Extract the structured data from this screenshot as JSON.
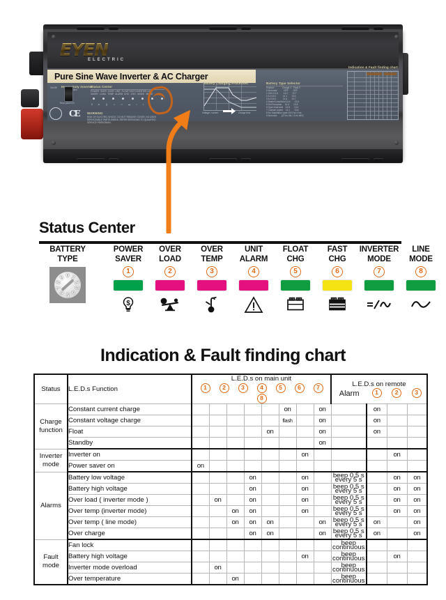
{
  "product": {
    "brand": "EYEN",
    "brand_sub": "ELECTRIC",
    "title_strip": "Pure Sine Wave Inverter & AC Charger",
    "panel_sections": {
      "heavy_duty": "Heavy Duty Inverter",
      "heavy_duty_sub": "Power switch",
      "status_center": "Status Center",
      "warning": "WARNING",
      "warning_body": "RISK OF ELECTRIC SHOCK. DO NOT REMOVE COVER. NO USER SERVICEABLE PARTS INSIDE. REFER SERVICING TO QUALIFIED SERVICE PERSONNEL.",
      "charging": "Battery Charging Processes",
      "charging_x": "Charge time",
      "charging_y": "Voltage / Current",
      "selector_title": "Battery Type Selector",
      "selector_cols": [
        "Position",
        "Charge V",
        "Float V"
      ],
      "selector_rows": [
        [
          "0 Not used",
          "OFF",
          "OFF"
        ],
        [
          "1 Gel U.S.A",
          "14.2",
          "13.7"
        ],
        [
          "2 A.G.M 1",
          "14.1",
          "13.4"
        ],
        [
          "3 A.G.M 2",
          "14.6",
          "13.7"
        ],
        [
          "4 Sealed Lead Acid",
          "14.4",
          "13.6"
        ],
        [
          "5 Gel European",
          "14.4",
          "13.8"
        ],
        [
          "6 Open lead acid",
          "14.8",
          "13.3"
        ],
        [
          "7 Calcium (open)",
          "14.1",
          "13.6"
        ],
        [
          "8 De Sulphation cycle 15.5 for 4 hrs",
          "",
          ""
        ],
        [
          "9 Not used",
          "(12 for 24v / 4 for 48V)",
          ""
        ]
      ],
      "chart_title": "Indication & Fault finding chart",
      "ce_mark": "CE"
    }
  },
  "status_center": {
    "title": "Status Center",
    "battery_type": {
      "line1": "BATTERY",
      "line2": "TYPE"
    },
    "dial": {
      "digits": [
        "0",
        "1",
        "2",
        "3",
        "4",
        "5",
        "6",
        "7",
        "8",
        "9"
      ]
    },
    "leds": [
      {
        "line1": "POWER",
        "line2": "SAVER",
        "number": "①",
        "color": "#00a14b",
        "icon": "power-saver-icon"
      },
      {
        "line1": "OVER",
        "line2": "LOAD",
        "number": "②",
        "color": "#e51080",
        "icon": "overload-scale-icon"
      },
      {
        "line1": "OVER",
        "line2": "TEMP",
        "number": "③",
        "color": "#e51080",
        "icon": "thermometer-icon"
      },
      {
        "line1": "UNIT",
        "line2": "ALARM",
        "number": "④",
        "color": "#e51080",
        "icon": "warning-triangle-icon"
      },
      {
        "line1": "FLOAT",
        "line2": "CHG",
        "number": "⑤",
        "color": "#0f9d3f",
        "icon": "battery-float-icon"
      },
      {
        "line1": "FAST",
        "line2": "CHG",
        "number": "⑥",
        "color": "#f5e314",
        "icon": "battery-fast-icon"
      },
      {
        "line1": "INVERTER",
        "line2": "MODE",
        "number": "⑦",
        "color": "#0f9d3f",
        "icon": "dc-ac-icon"
      },
      {
        "line1": "LINE",
        "line2": "MODE",
        "number": "⑧",
        "color": "#0f9d3f",
        "icon": "ac-wave-icon"
      }
    ]
  },
  "fault_chart": {
    "title": "Indication & Fault finding chart",
    "headers": {
      "status": "Status",
      "function": "L.E.D.s Function",
      "main_unit": "L.E.D.s on main unit",
      "remote": "L.E.D.s on remote",
      "alarm": "Alarm",
      "main_numbers": [
        "①",
        "②",
        "③",
        "④",
        "⑤",
        "⑥",
        "⑦",
        "⑧"
      ],
      "remote_numbers": [
        "①",
        "②",
        "③"
      ]
    },
    "groups": [
      {
        "name": "Charge\nfunction",
        "name_lines": [
          "Charge",
          "function"
        ],
        "rows": [
          {
            "function": "Constant current charge",
            "main": [
              "",
              "",
              "",
              "",
              "",
              "on",
              "",
              "on"
            ],
            "alarm": "",
            "remote": [
              "on",
              "",
              ""
            ]
          },
          {
            "function": "Constant voltage charge",
            "main": [
              "",
              "",
              "",
              "",
              "",
              "flash",
              "",
              "on"
            ],
            "alarm": "",
            "remote": [
              "on",
              "",
              ""
            ]
          },
          {
            "function": "Float",
            "main": [
              "",
              "",
              "",
              "",
              "on",
              "",
              "",
              "on"
            ],
            "alarm": "",
            "remote": [
              "on",
              "",
              ""
            ]
          },
          {
            "function": "Standby",
            "main": [
              "",
              "",
              "",
              "",
              "",
              "",
              "",
              "on"
            ],
            "alarm": "",
            "remote": [
              "",
              "",
              ""
            ]
          }
        ]
      },
      {
        "name_lines": [
          "Inverter",
          "mode"
        ],
        "rows": [
          {
            "function": "Inverter on",
            "main": [
              "",
              "",
              "",
              "",
              "",
              "",
              "on",
              ""
            ],
            "alarm": "",
            "remote": [
              "",
              "on",
              ""
            ]
          },
          {
            "function": "Power saver on",
            "main": [
              "on",
              "",
              "",
              "",
              "",
              "",
              "",
              ""
            ],
            "alarm": "",
            "remote": [
              "",
              "",
              ""
            ]
          }
        ]
      },
      {
        "name_lines": [
          "Alarms"
        ],
        "rows": [
          {
            "function": "Battery low voltage",
            "main": [
              "",
              "",
              "",
              "on",
              "",
              "",
              "on",
              ""
            ],
            "alarm": "beep 0.5 s\nevery 5 s",
            "remote": [
              "",
              "on",
              "on"
            ]
          },
          {
            "function": "Battery  high voltage",
            "main": [
              "",
              "",
              "",
              "on",
              "",
              "",
              "on",
              ""
            ],
            "alarm": "beep 0.5 s\nevery 5 s",
            "remote": [
              "",
              "on",
              "on"
            ]
          },
          {
            "function": "Over load ( inverter mode )",
            "main": [
              "",
              "on",
              "",
              "on",
              "",
              "",
              "on",
              ""
            ],
            "alarm": "beep 0.5 s\nevery 5 s",
            "remote": [
              "",
              "on",
              "on"
            ]
          },
          {
            "function": "Over temp (inverter mode)",
            "main": [
              "",
              "",
              "on",
              "on",
              "",
              "",
              "on",
              ""
            ],
            "alarm": "beep 0.5 s\nevery 5 s",
            "remote": [
              "",
              "on",
              "on"
            ]
          },
          {
            "function": "Over temp ( line mode)",
            "main": [
              "",
              "",
              "on",
              "on",
              "on",
              "",
              "",
              "on"
            ],
            "alarm": "beep 0.5 s\nevery 5 s",
            "remote": [
              "on",
              "",
              "on"
            ]
          },
          {
            "function": "Over charge",
            "main": [
              "",
              "",
              "",
              "on",
              "on",
              "",
              "",
              "on"
            ],
            "alarm": "beep 0.5 s\nevery 5 s",
            "remote": [
              "on",
              "",
              "on"
            ]
          }
        ]
      },
      {
        "name_lines": [
          "Fault",
          "mode"
        ],
        "rows": [
          {
            "function": "Fan lock",
            "main": [
              "",
              "",
              "",
              "",
              "",
              "",
              "",
              ""
            ],
            "alarm": "beep\ncontinuous",
            "remote": [
              "",
              "",
              ""
            ]
          },
          {
            "function": "Battery high voltage",
            "main": [
              "",
              "",
              "",
              "",
              "",
              "",
              "on",
              ""
            ],
            "alarm": "beep\ncontinuous",
            "remote": [
              "",
              "on",
              ""
            ]
          },
          {
            "function": "Inverter mode overload",
            "main": [
              "",
              "on",
              "",
              "",
              "",
              "",
              "",
              ""
            ],
            "alarm": "beep\ncontinuous",
            "remote": [
              "",
              "",
              ""
            ]
          },
          {
            "function": "Over temperature",
            "main": [
              "",
              "",
              "on",
              "",
              "",
              "",
              "",
              ""
            ],
            "alarm": "beep\ncontinuous",
            "remote": [
              "",
              "",
              ""
            ]
          }
        ]
      }
    ]
  },
  "colors": {
    "accent_orange": "#e06a14",
    "led_green": "#0f9d3f",
    "led_magenta": "#e51080",
    "led_yellow": "#f5e314",
    "text": "#111111"
  }
}
